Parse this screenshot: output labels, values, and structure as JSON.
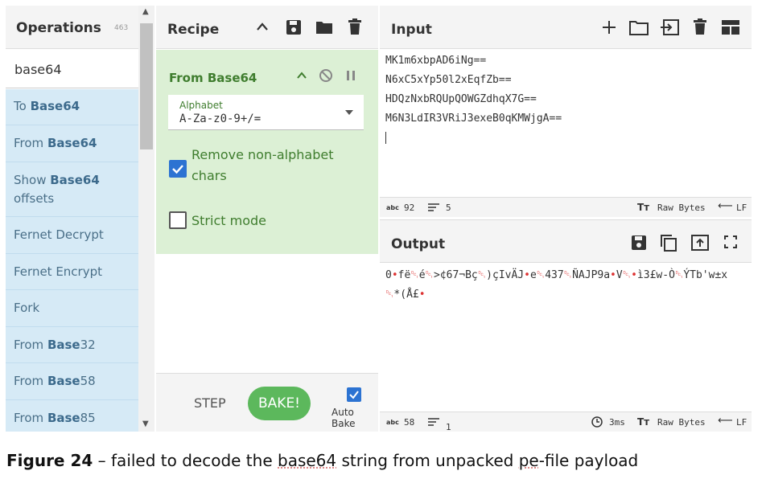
{
  "operations": {
    "title": "Operations",
    "count": "463",
    "search_value": "base64",
    "items": [
      {
        "pre": "To ",
        "bold": "Base64",
        "post": ""
      },
      {
        "pre": "From ",
        "bold": "Base64",
        "post": ""
      },
      {
        "pre": "Show ",
        "bold": "Base64",
        "post": "",
        "line2": "offsets"
      },
      {
        "pre": "Fernet Decrypt",
        "bold": "",
        "post": ""
      },
      {
        "pre": "Fernet Encrypt",
        "bold": "",
        "post": ""
      },
      {
        "pre": "Fork",
        "bold": "",
        "post": ""
      },
      {
        "pre": "From ",
        "bold": "Base",
        "post": "32"
      },
      {
        "pre": "From ",
        "bold": "Base",
        "post": "58"
      },
      {
        "pre": "From ",
        "bold": "Base",
        "post": "85"
      }
    ]
  },
  "recipe": {
    "title": "Recipe",
    "operation_name": "From Base64",
    "alphabet_label": "Alphabet",
    "alphabet_value": "A-Za-z0-9+/=",
    "remove_label_1": "Remove non-alphabet",
    "remove_label_2": "chars",
    "strict_label": "Strict mode",
    "step_label": "STEP",
    "bake_label": "BAKE!",
    "autobake_label": "Auto Bake"
  },
  "input": {
    "title": "Input",
    "lines": [
      "MK1m6xbpAD6iNg==",
      "N6xC5xYp50l2xEqfZb==",
      "HDQzNxbRQUpQOWGZdhqX7G==",
      "M6N3LdIR3VRiJ3exeB0qKMWjgA=="
    ],
    "abc_label": "abc",
    "length": "92",
    "lines_count": "5",
    "raw_bytes": "Raw Bytes",
    "eol": "LF"
  },
  "output": {
    "title": "Output",
    "line1": "0•fë␑é␑>¢67¬Bç␑)çIvÄJ•e␑437␑ÑAJP9a•V␑•ì3£w-Ò␑ÝTb'w±x",
    "line2": "␑*(Å£•",
    "abc_label": "abc",
    "length": "58",
    "lines_count": "1",
    "time": "3ms",
    "raw_bytes": "Raw Bytes",
    "eol": "LF"
  },
  "caption": {
    "fig": "Figure 24",
    "dash": "–",
    "text_a": "failed to decode the ",
    "text_b": "base64",
    "text_c": " string from unpacked ",
    "text_d": "pe",
    "text_e": "-file payload"
  }
}
